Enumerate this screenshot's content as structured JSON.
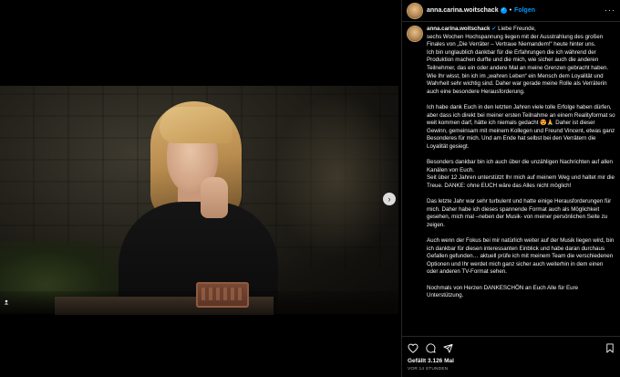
{
  "post": {
    "username": "anna.carina.woitschack",
    "follow_label": "Folgen",
    "separator": "•",
    "more_label": "···",
    "caption_username": "anna.carina.woitschack",
    "caption_paragraphs": [
      "Liebe Freunde,\nsechs Wochen Hochspannung liegen mit der Ausstrahlung des großen Finales von „Die Verräter – Vertraue Niemandem!“ heute hinter uns.\nIch bin unglaublich dankbar für die Erfahrungen die ich während der Produktion machen durfte und die mich, wie sicher auch die anderen Teilnehmer, das ein oder andere Mal an meine Grenzen gebracht haben.\nWie Ihr wisst, bin ich im „wahren Leben“ ein Mensch dem Loyalität und Wahrheit sehr wichtig sind. Daher war gerade meine Rolle als Verräterin auch eine besondere Herausforderung.",
      "Ich habe dank Euch in den letzten Jahren viele tolle Erfolge haben dürfen, aber dass ich direkt bei meiner ersten Teilnahme an einem Realityformat so weit kommen darf, hätte ich niemals gedacht 😍🙏 Daher ist dieser Gewinn, gemeinsam mit meinem Kollegen und Freund Vincent, etwas ganz Besonderes für mich. Und am Ende hat selbst bei den Verrätern die Loyalität gesiegt.",
      "Besonders dankbar bin ich auch über die unzähligen Nachrichten auf allen Kanälen von Euch.\nSeit über 12 Jahren unterstützt Ihr mich auf meinem Weg und haltet mir die Treue. DANKE: ohne EUCH wäre das Alles nicht möglich!",
      "Das letzte Jahr war sehr turbulent und hatte einige Herausforderungen für mich. Daher habe ich dieses spannende Format auch als Möglichkeit gesehen, mich mal –neben der Musik- von meiner persönlichen Seite zu zeigen.",
      "Auch wenn der Fokus bei mir natürlich weiter auf der Musik liegen wird, bin ich dankbar für diesen interessanten Einblick und habe daran durchaus Gefallen gefunden… aktuell prüfe ich mit meinem Team die verschiedenen Optionen und Ihr werdet mich ganz sicher auch weiterhin in dem einen oder anderen TV-Format sehen.",
      "Nochmals von Herzen DANKESCHÖN an Euch Alle für Eure Unterstützung."
    ],
    "likes": "Gefällt 3.126 Mal",
    "time_ago": "VOR 14 STUNDEN"
  },
  "icons": {
    "like": "heart-icon",
    "comment": "comment-icon",
    "share": "share-icon",
    "save": "bookmark-icon",
    "next": "chevron-right-icon",
    "tag": "user-tag-icon",
    "verified": "verified-badge-icon"
  },
  "colors": {
    "accent": "#0095f6",
    "background": "#000000",
    "text": "#f5f5f5",
    "muted": "#a8a8a8",
    "divider": "#262626"
  }
}
